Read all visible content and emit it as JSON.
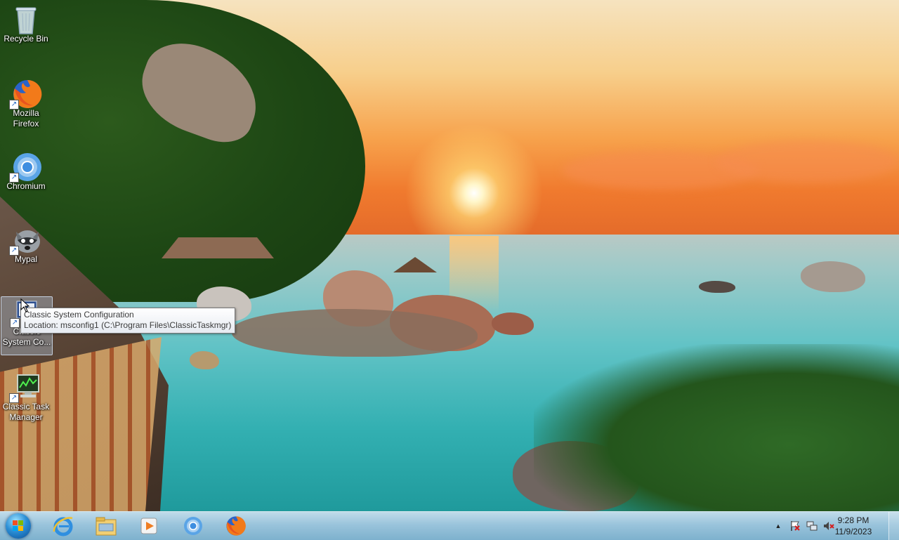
{
  "desktop": {
    "icons": [
      {
        "label": "Recycle Bin",
        "icon": "recycle-bin-icon"
      },
      {
        "label": "Mozilla Firefox",
        "icon": "firefox-icon"
      },
      {
        "label": "Chromium",
        "icon": "chromium-icon"
      },
      {
        "label": "Mypal",
        "icon": "mypal-icon"
      },
      {
        "label": "Classic System Co...",
        "icon": "msconfig-icon"
      },
      {
        "label": "Classic Task Manager",
        "icon": "task-manager-icon"
      }
    ],
    "tooltip": {
      "line1": "Classic System Configuration",
      "line2": "Location: msconfig1 (C:\\Program Files\\ClassicTaskmgr)"
    }
  },
  "taskbar": {
    "start": {
      "icon": "windows-start-icon"
    },
    "pinned": [
      {
        "icon": "internet-explorer-icon"
      },
      {
        "icon": "file-explorer-icon"
      },
      {
        "icon": "media-player-icon"
      },
      {
        "icon": "chromium-icon"
      },
      {
        "icon": "firefox-icon"
      }
    ],
    "tray": {
      "chevron": "▲",
      "icons": [
        "action-center-icon",
        "network-icon",
        "volume-muted-icon"
      ]
    },
    "clock": {
      "time": "9:28 PM",
      "date": "11/9/2023"
    }
  },
  "colors": {
    "taskbar": "#a9cbe0",
    "selection": "#bed7f0"
  }
}
